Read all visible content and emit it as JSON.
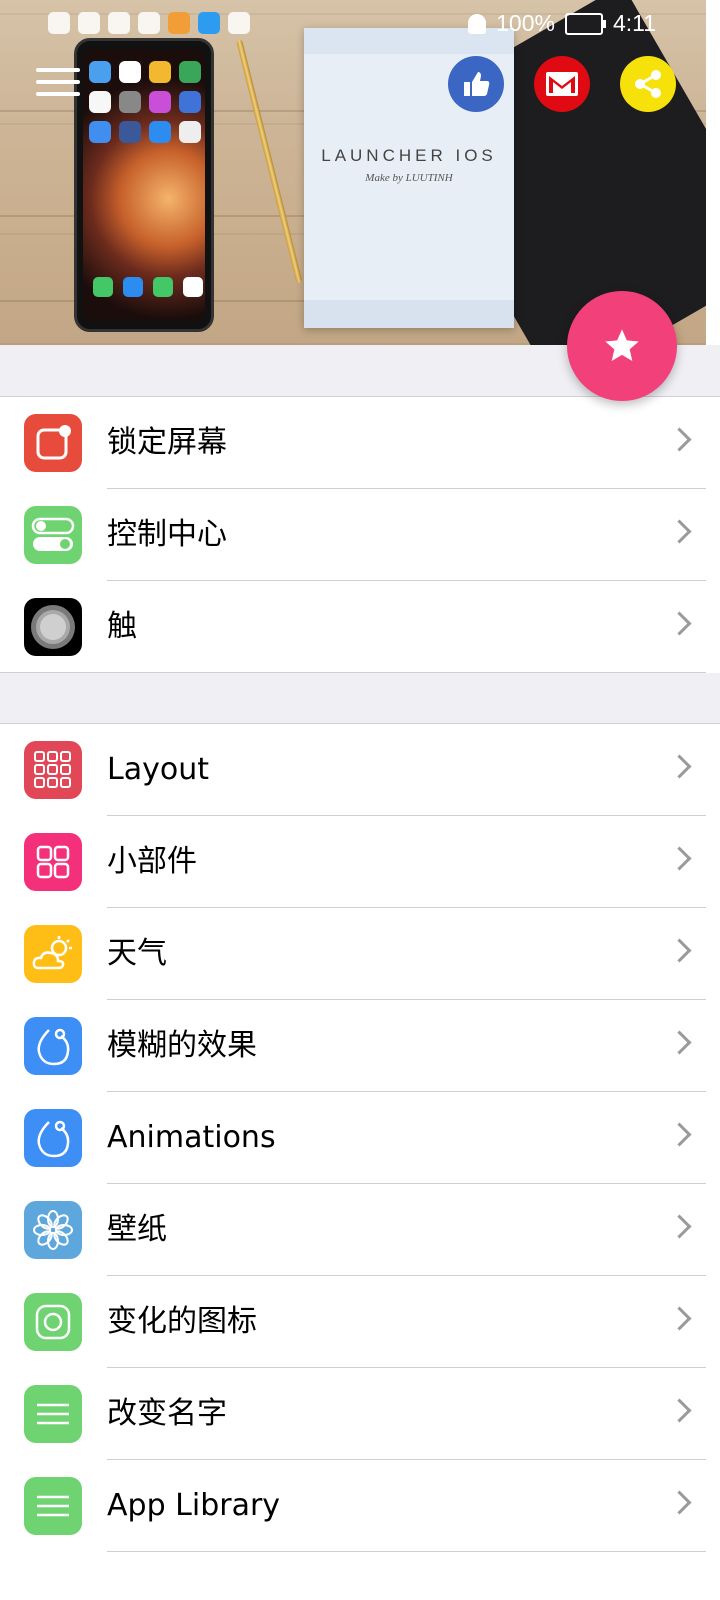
{
  "status_bar": {
    "battery": "100%",
    "time": "4:11"
  },
  "banner": {
    "booklet_title": "LAUNCHER IOS",
    "booklet_subtitle": "Make by LUUTINH"
  },
  "colors": {
    "like": "#3b66c4",
    "gmail": "#e00a12",
    "share": "#f7e10b",
    "fab": "#f2407a",
    "section_bg": "#efeff4"
  },
  "section1": [
    {
      "label": "锁定屏幕",
      "icon": "lock-screen-icon",
      "color": "#e64b3c"
    },
    {
      "label": "控制中心",
      "icon": "control-center-icon",
      "color": "#6fd372"
    },
    {
      "label": "触",
      "icon": "assistive-touch-icon",
      "color": "#000000"
    }
  ],
  "section2": [
    {
      "label": "Layout",
      "icon": "grid-layout-icon",
      "color": "#e24757"
    },
    {
      "label": "小部件",
      "icon": "widgets-icon",
      "color": "#f5307a"
    },
    {
      "label": "天气",
      "icon": "weather-icon",
      "color": "#ffbe16"
    },
    {
      "label": "模糊的效果",
      "icon": "blur-effect-icon",
      "color": "#3e8ff5"
    },
    {
      "label": "Animations",
      "icon": "animations-icon",
      "color": "#3e8ff5"
    },
    {
      "label": "壁纸",
      "icon": "wallpaper-icon",
      "color": "#5ea7dc"
    },
    {
      "label": "变化的图标",
      "icon": "change-icon-icon",
      "color": "#6fd372"
    },
    {
      "label": "改变名字",
      "icon": "rename-icon",
      "color": "#6fd372"
    },
    {
      "label": "App Library",
      "icon": "app-library-icon",
      "color": "#6fd372"
    }
  ]
}
